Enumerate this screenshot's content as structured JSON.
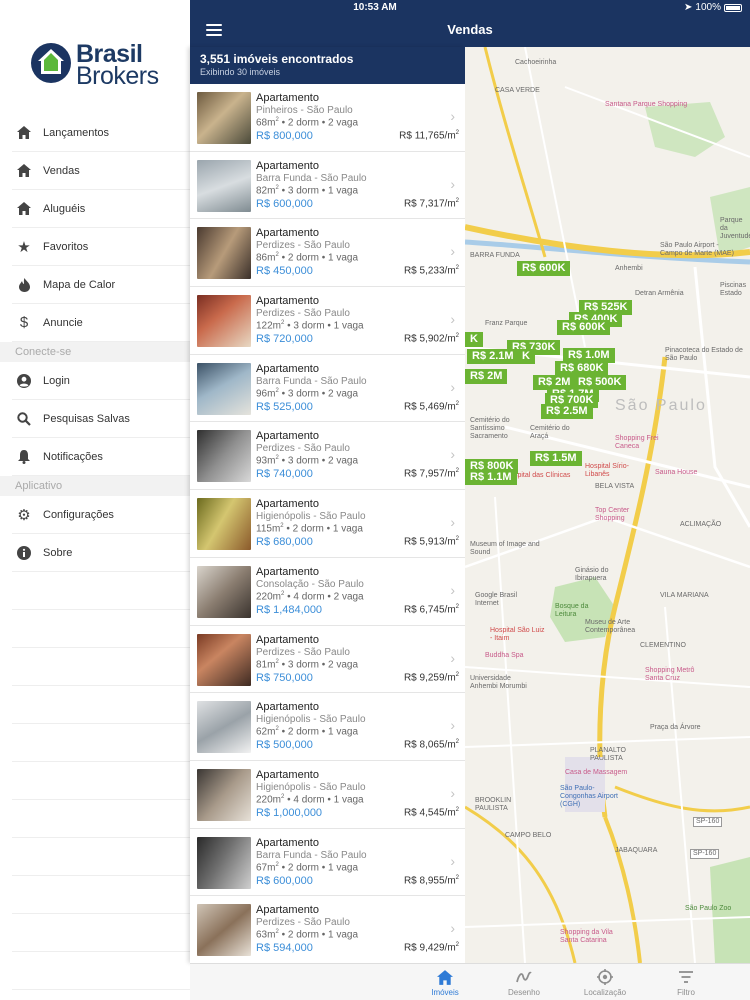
{
  "status": {
    "time": "10:53 AM",
    "battery": "100%"
  },
  "brand": {
    "line1": "Brasil",
    "line2": "Brokers"
  },
  "menu": {
    "items_top": [
      {
        "label": "Lançamentos",
        "icon": "home-icon"
      },
      {
        "label": "Vendas",
        "icon": "home-icon"
      },
      {
        "label": "Aluguéis",
        "icon": "home-icon"
      },
      {
        "label": "Favoritos",
        "icon": "star-icon"
      },
      {
        "label": "Mapa de Calor",
        "icon": "flame-icon"
      },
      {
        "label": "Anuncie",
        "icon": "dollar-icon"
      }
    ],
    "section_connect": "Conecte-se",
    "items_connect": [
      {
        "label": "Login",
        "icon": "user-icon"
      },
      {
        "label": "Pesquisas Salvas",
        "icon": "search-icon"
      },
      {
        "label": "Notificações",
        "icon": "bell-icon"
      }
    ],
    "section_app": "Aplicativo",
    "items_app": [
      {
        "label": "Configurações",
        "icon": "gear-icon"
      },
      {
        "label": "Sobre",
        "icon": "info-icon"
      }
    ]
  },
  "navbar": {
    "title": "Vendas"
  },
  "summary": {
    "count": "3,551 imóveis encontrados",
    "showing": "Exibindo 30 imóveis"
  },
  "listings": [
    {
      "type": "Apartamento",
      "location": "Pinheiros - São Paulo",
      "area": "68m",
      "specs": " • 2 dorm • 2 vaga",
      "price": "R$ 800,000",
      "ppm": "R$ 11,765/m"
    },
    {
      "type": "Apartamento",
      "location": "Barra Funda - São Paulo",
      "area": "82m",
      "specs": " • 3 dorm • 1 vaga",
      "price": "R$ 600,000",
      "ppm": "R$ 7,317/m"
    },
    {
      "type": "Apartamento",
      "location": "Perdizes - São Paulo",
      "area": "86m",
      "specs": " • 2 dorm • 1 vaga",
      "price": "R$ 450,000",
      "ppm": "R$ 5,233/m"
    },
    {
      "type": "Apartamento",
      "location": "Perdizes - São Paulo",
      "area": "122m",
      "specs": " • 3 dorm • 1 vaga",
      "price": "R$ 720,000",
      "ppm": "R$ 5,902/m"
    },
    {
      "type": "Apartamento",
      "location": "Barra Funda - São Paulo",
      "area": "96m",
      "specs": " • 3 dorm • 2 vaga",
      "price": "R$ 525,000",
      "ppm": "R$ 5,469/m"
    },
    {
      "type": "Apartamento",
      "location": "Perdizes - São Paulo",
      "area": "93m",
      "specs": " • 3 dorm • 2 vaga",
      "price": "R$ 740,000",
      "ppm": "R$ 7,957/m"
    },
    {
      "type": "Apartamento",
      "location": "Higienópolis - São Paulo",
      "area": "115m",
      "specs": " • 2 dorm • 1 vaga",
      "price": "R$ 680,000",
      "ppm": "R$ 5,913/m"
    },
    {
      "type": "Apartamento",
      "location": "Consolação - São Paulo",
      "area": "220m",
      "specs": " • 4 dorm • 2 vaga",
      "price": "R$ 1,484,000",
      "ppm": "R$ 6,745/m"
    },
    {
      "type": "Apartamento",
      "location": "Perdizes - São Paulo",
      "area": "81m",
      "specs": " • 3 dorm • 2 vaga",
      "price": "R$ 750,000",
      "ppm": "R$ 9,259/m"
    },
    {
      "type": "Apartamento",
      "location": "Higienópolis - São Paulo",
      "area": "62m",
      "specs": " • 2 dorm • 1 vaga",
      "price": "R$ 500,000",
      "ppm": "R$ 8,065/m"
    },
    {
      "type": "Apartamento",
      "location": "Higienópolis - São Paulo",
      "area": "220m",
      "specs": " • 4 dorm • 1 vaga",
      "price": "R$ 1,000,000",
      "ppm": "R$ 4,545/m"
    },
    {
      "type": "Apartamento",
      "location": "Barra Funda - São Paulo",
      "area": "67m",
      "specs": " • 2 dorm • 1 vaga",
      "price": "R$ 600,000",
      "ppm": "R$ 8,955/m"
    },
    {
      "type": "Apartamento",
      "location": "Perdizes - São Paulo",
      "area": "63m",
      "specs": " • 2 dorm • 1 vaga",
      "price": "R$ 594,000",
      "ppm": "R$ 9,429/m"
    }
  ],
  "map": {
    "labels": [
      "CASA VERDE",
      "Cachoeirinha",
      "Santana Parque Shopping",
      "BARRA FUNDA",
      "Anhembi",
      "São Paulo Airport - Campo de Marte (MAE)",
      "Parque da Juventude",
      "Detran Armênia",
      "Piscinas Estado",
      "Franz Parque",
      "São Paulo",
      "Pinacoteca do Estado de São Paulo",
      "Cemitério do Santíssimo Sacramento",
      "Cemitério do Araçá",
      "Shopping Frei Caneca",
      "Hospital Sírio-Libanês",
      "Hospital das Clínicas",
      "BELA VISTA",
      "Sauna House",
      "Top Center Shopping",
      "ACLIMAÇÃO",
      "Museum of Image and Sound",
      "Ginásio do Ibirapuera",
      "Google Brasil Internet",
      "Bosque da Leitura",
      "Museu de Arte Contemporânea",
      "VILA MARIANA",
      "Hospital São Luiz - Itaim",
      "Buddha Spa",
      "CLEMENTINO",
      "Universidade Anhembi Morumbi",
      "Shopping Metrô Santa Cruz",
      "Praça da Árvore",
      "PLANALTO PAULISTA",
      "Casa de Massagem",
      "São Paulo-Congonhas Airport (CGH)",
      "BROOKLIN PAULISTA",
      "CAMPO BELO",
      "JABAQUARA",
      "SP-160",
      "São Paulo Zoo",
      "Shopping da Vila Santa Catarina"
    ],
    "prices": [
      "R$ 600K",
      "R$ 525K",
      "R$ 400K",
      "R$ 600K",
      "R$ 730K",
      "R$ 2.1M",
      "R$ 1.0M",
      "R$ 680K",
      "R$ 2M",
      "R$ 2M",
      "R$ 500K",
      "R$ 1.7M",
      "R$ 700K",
      "R$ 2.5M",
      "R$ 1.5M",
      "R$ 800K",
      "R$ 1.1M",
      "K",
      "K"
    ]
  },
  "tabs": [
    {
      "label": "Imóveis",
      "icon": "home-icon",
      "active": true
    },
    {
      "label": "Desenho",
      "icon": "draw-icon",
      "active": false
    },
    {
      "label": "Localização",
      "icon": "location-icon",
      "active": false
    },
    {
      "label": "Filtro",
      "icon": "filter-icon",
      "active": false
    }
  ],
  "colors": {
    "navy": "#1b3461",
    "price_blue": "#3c8ed8",
    "pill_green": "#6bb433"
  }
}
